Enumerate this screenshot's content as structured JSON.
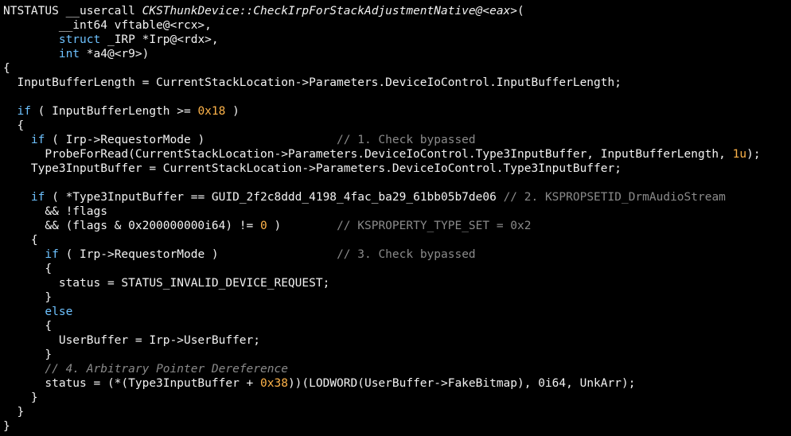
{
  "colors": {
    "background": "#000000",
    "text": "#f2f2f2",
    "keyword": "#6ec2ff",
    "number": "#ffb44a",
    "comment": "#8a8a8a",
    "function": "#f2f2f2"
  },
  "code": {
    "lines": [
      [
        {
          "t": "NTSTATUS __usercall ",
          "c": "text"
        },
        {
          "t": "CKSThunkDevice::CheckIrpForStackAdjustmentNative@<eax>",
          "c": "function",
          "i": true
        },
        {
          "t": "(",
          "c": "text"
        }
      ],
      [
        {
          "t": "        __int64 vftable@<rcx>,",
          "c": "text"
        }
      ],
      [
        {
          "t": "        ",
          "c": "text"
        },
        {
          "t": "struct",
          "c": "keyword"
        },
        {
          "t": " _IRP *Irp@<rdx>,",
          "c": "text"
        }
      ],
      [
        {
          "t": "        ",
          "c": "text"
        },
        {
          "t": "int",
          "c": "keyword"
        },
        {
          "t": " *a4@<r9>)",
          "c": "text"
        }
      ],
      [
        {
          "t": "{",
          "c": "text"
        }
      ],
      [
        {
          "t": "  InputBufferLength = CurrentStackLocation->Parameters.DeviceIoControl.InputBufferLength;",
          "c": "text"
        }
      ],
      [
        {
          "t": "",
          "c": "text"
        }
      ],
      [
        {
          "t": "  ",
          "c": "text"
        },
        {
          "t": "if",
          "c": "keyword"
        },
        {
          "t": " ( InputBufferLength >= ",
          "c": "text"
        },
        {
          "t": "0x18",
          "c": "number"
        },
        {
          "t": " )",
          "c": "text"
        }
      ],
      [
        {
          "t": "  {",
          "c": "text"
        }
      ],
      [
        {
          "t": "    ",
          "c": "text"
        },
        {
          "t": "if",
          "c": "keyword"
        },
        {
          "t": " ( Irp->RequestorMode )                   ",
          "c": "text"
        },
        {
          "t": "// 1. Check bypassed",
          "c": "comment"
        }
      ],
      [
        {
          "t": "      ProbeForRead(CurrentStackLocation->Parameters.DeviceIoControl.Type3InputBuffer, InputBufferLength, ",
          "c": "text"
        },
        {
          "t": "1u",
          "c": "number"
        },
        {
          "t": ");",
          "c": "text"
        }
      ],
      [
        {
          "t": "    Type3InputBuffer = CurrentStackLocation->Parameters.DeviceIoControl.Type3InputBuffer;",
          "c": "text"
        }
      ],
      [
        {
          "t": "",
          "c": "text"
        }
      ],
      [
        {
          "t": "    ",
          "c": "text"
        },
        {
          "t": "if",
          "c": "keyword"
        },
        {
          "t": " ( *Type3InputBuffer == GUID_2f2c8ddd_4198_4fac_ba29_61bb05b7de06 ",
          "c": "text"
        },
        {
          "t": "// 2. KSPROPSETID_DrmAudioStream",
          "c": "comment"
        }
      ],
      [
        {
          "t": "      && !flags",
          "c": "text"
        }
      ],
      [
        {
          "t": "      && (flags & 0x200000000i64) != ",
          "c": "text"
        },
        {
          "t": "0",
          "c": "number"
        },
        {
          "t": " )        ",
          "c": "text"
        },
        {
          "t": "// KSPROPERTY_TYPE_SET = 0x2",
          "c": "comment"
        }
      ],
      [
        {
          "t": "    {",
          "c": "text"
        }
      ],
      [
        {
          "t": "      ",
          "c": "text"
        },
        {
          "t": "if",
          "c": "keyword"
        },
        {
          "t": " ( Irp->RequestorMode )                 ",
          "c": "text"
        },
        {
          "t": "// 3. Check bypassed",
          "c": "comment"
        }
      ],
      [
        {
          "t": "      {",
          "c": "text"
        }
      ],
      [
        {
          "t": "        status = STATUS_INVALID_DEVICE_REQUEST;",
          "c": "text"
        }
      ],
      [
        {
          "t": "      }",
          "c": "text"
        }
      ],
      [
        {
          "t": "      ",
          "c": "text"
        },
        {
          "t": "else",
          "c": "keyword"
        }
      ],
      [
        {
          "t": "      {",
          "c": "text"
        }
      ],
      [
        {
          "t": "        UserBuffer = Irp->UserBuffer;",
          "c": "text"
        }
      ],
      [
        {
          "t": "      }",
          "c": "text"
        }
      ],
      [
        {
          "t": "      ",
          "c": "text"
        },
        {
          "t": "// 4. Arbitrary Pointer Dereference",
          "c": "comment",
          "i": true
        }
      ],
      [
        {
          "t": "      status = (*(Type3InputBuffer + ",
          "c": "text"
        },
        {
          "t": "0x38",
          "c": "number"
        },
        {
          "t": "))(LODWORD(UserBuffer->FakeBitmap), 0i64, UnkArr);",
          "c": "text"
        }
      ],
      [
        {
          "t": "    }",
          "c": "text"
        }
      ],
      [
        {
          "t": "  }",
          "c": "text"
        }
      ],
      [
        {
          "t": "}",
          "c": "text"
        }
      ]
    ]
  }
}
